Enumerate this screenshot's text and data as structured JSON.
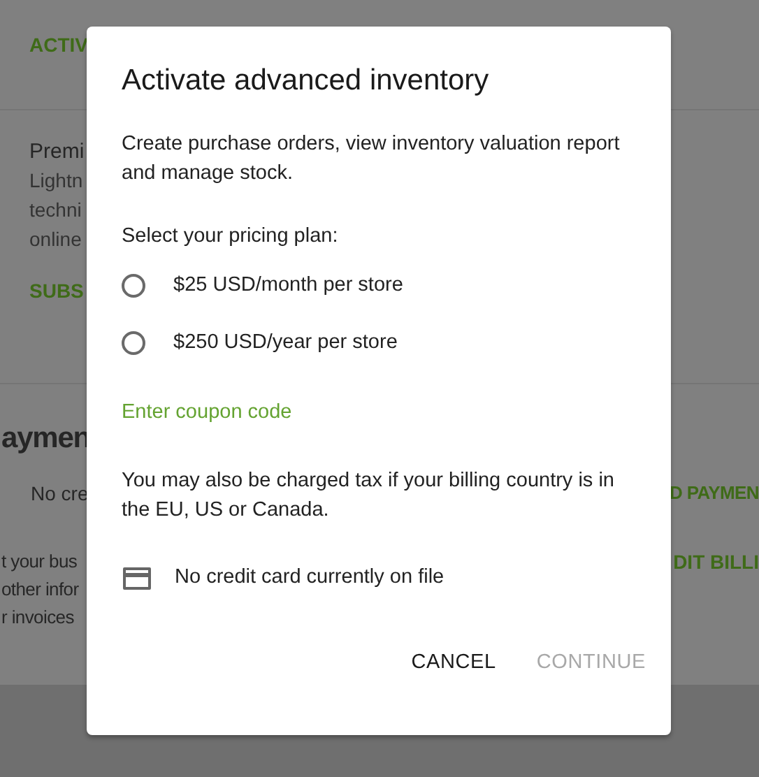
{
  "background": {
    "activate_link": "ACTIV",
    "plan_title": "Premi",
    "plan_description": [
      "Lightn",
      "techni",
      "online"
    ],
    "subscribe_link": "SUBS",
    "payment_heading": "aymen",
    "payment_status": "No cre",
    "add_payment_link": "D PAYMEN",
    "billing_description": [
      "t your bus",
      "other infor",
      "r invoices"
    ],
    "edit_billing_link": "DIT BILLI"
  },
  "dialog": {
    "title": "Activate advanced inventory",
    "description": "Create purchase orders, view inventory valuation report and manage stock.",
    "plan_prompt": "Select your pricing plan:",
    "plans": [
      {
        "label": "$25 USD/month per store",
        "selected": false
      },
      {
        "label": "$250 USD/year per store",
        "selected": false
      }
    ],
    "coupon_link": "Enter coupon code",
    "tax_note": "You may also be charged tax if your billing country is in the EU, US or Canada.",
    "card_status": "No credit card currently on file",
    "buttons": [
      {
        "label": "CANCEL",
        "disabled": false
      },
      {
        "label": "CONTINUE",
        "disabled": true
      }
    ]
  }
}
